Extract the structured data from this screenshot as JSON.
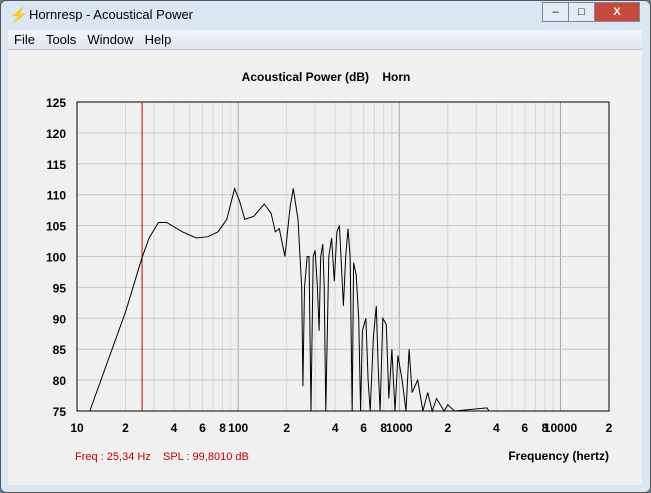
{
  "window": {
    "title": "Hornresp - Acoustical Power",
    "minimize": "–",
    "maximize": "□",
    "close": "X"
  },
  "menu": [
    "File",
    "Tools",
    "Window",
    "Help"
  ],
  "status": {
    "freq": "Freq : 25,34 Hz",
    "spl": "SPL : 99,8010 dB"
  },
  "colors": {
    "curve": "#000000",
    "cursor": "#c00000",
    "grid": "#c8c8c8"
  },
  "chart_data": {
    "type": "line",
    "title": "Acoustical Power (dB)    Horn",
    "xlabel": "Frequency (hertz)",
    "ylabel": "",
    "xscale": "log",
    "xlim": [
      10,
      20000
    ],
    "ylim": [
      75,
      125
    ],
    "yticks": [
      "125",
      "120",
      "115",
      "110",
      "105",
      "100",
      "95",
      "90",
      "85",
      "80",
      "75"
    ],
    "xticks": [
      {
        "v": 10,
        "l": "10"
      },
      {
        "v": 20,
        "l": "2"
      },
      {
        "v": 40,
        "l": "4"
      },
      {
        "v": 60,
        "l": "6"
      },
      {
        "v": 80,
        "l": "8"
      },
      {
        "v": 100,
        "l": "100"
      },
      {
        "v": 200,
        "l": "2"
      },
      {
        "v": 400,
        "l": "4"
      },
      {
        "v": 600,
        "l": "6"
      },
      {
        "v": 800,
        "l": "8"
      },
      {
        "v": 1000,
        "l": "1000"
      },
      {
        "v": 2000,
        "l": "2"
      },
      {
        "v": 4000,
        "l": "4"
      },
      {
        "v": 6000,
        "l": "6"
      },
      {
        "v": 8000,
        "l": "8"
      },
      {
        "v": 10000,
        "l": "10000"
      },
      {
        "v": 20000,
        "l": "2"
      }
    ],
    "cursor_freq": 25.34,
    "series": [
      {
        "name": "Horn",
        "points": [
          [
            12,
            75
          ],
          [
            15,
            82
          ],
          [
            20,
            91
          ],
          [
            25.3,
            99.8
          ],
          [
            28,
            103
          ],
          [
            32,
            105.5
          ],
          [
            36,
            105.5
          ],
          [
            45,
            104
          ],
          [
            55,
            103
          ],
          [
            65,
            103.2
          ],
          [
            75,
            104
          ],
          [
            85,
            106
          ],
          [
            95,
            111
          ],
          [
            102,
            109
          ],
          [
            110,
            106
          ],
          [
            125,
            106.5
          ],
          [
            145,
            108.5
          ],
          [
            160,
            107
          ],
          [
            170,
            104
          ],
          [
            180,
            104.5
          ],
          [
            195,
            100
          ],
          [
            210,
            108
          ],
          [
            220,
            111
          ],
          [
            235,
            106
          ],
          [
            248,
            95
          ],
          [
            252,
            79
          ],
          [
            258,
            95
          ],
          [
            268,
            100
          ],
          [
            275,
            100
          ],
          [
            283,
            75
          ],
          [
            292,
            100
          ],
          [
            300,
            101
          ],
          [
            310,
            95
          ],
          [
            318,
            88
          ],
          [
            325,
            100
          ],
          [
            335,
            102
          ],
          [
            342,
            95
          ],
          [
            350,
            75
          ],
          [
            365,
            100
          ],
          [
            380,
            103
          ],
          [
            395,
            96
          ],
          [
            410,
            104
          ],
          [
            425,
            105
          ],
          [
            440,
            97
          ],
          [
            450,
            92
          ],
          [
            465,
            100
          ],
          [
            480,
            104.5
          ],
          [
            495,
            100
          ],
          [
            510,
            75
          ],
          [
            520,
            99
          ],
          [
            540,
            97
          ],
          [
            560,
            90
          ],
          [
            575,
            75
          ],
          [
            590,
            88
          ],
          [
            620,
            90
          ],
          [
            640,
            80
          ],
          [
            660,
            75
          ],
          [
            690,
            87
          ],
          [
            720,
            92
          ],
          [
            740,
            82
          ],
          [
            760,
            75
          ],
          [
            790,
            90
          ],
          [
            830,
            89
          ],
          [
            860,
            77
          ],
          [
            900,
            85
          ],
          [
            940,
            75
          ],
          [
            980,
            84
          ],
          [
            1040,
            80
          ],
          [
            1100,
            75
          ],
          [
            1150,
            85
          ],
          [
            1200,
            78
          ],
          [
            1300,
            80
          ],
          [
            1400,
            75
          ],
          [
            1500,
            78
          ],
          [
            1600,
            75
          ],
          [
            1700,
            77
          ],
          [
            1900,
            75
          ],
          [
            2000,
            76
          ],
          [
            2200,
            75
          ],
          [
            3500,
            75.5
          ],
          [
            3600,
            75
          ]
        ]
      }
    ]
  }
}
